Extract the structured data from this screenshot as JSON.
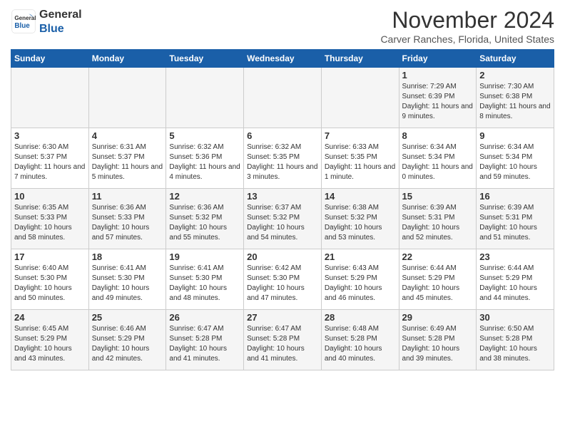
{
  "header": {
    "logo_general": "General",
    "logo_blue": "Blue",
    "month_title": "November 2024",
    "location": "Carver Ranches, Florida, United States"
  },
  "weekdays": [
    "Sunday",
    "Monday",
    "Tuesday",
    "Wednesday",
    "Thursday",
    "Friday",
    "Saturday"
  ],
  "weeks": [
    [
      {
        "day": "",
        "text": ""
      },
      {
        "day": "",
        "text": ""
      },
      {
        "day": "",
        "text": ""
      },
      {
        "day": "",
        "text": ""
      },
      {
        "day": "",
        "text": ""
      },
      {
        "day": "1",
        "text": "Sunrise: 7:29 AM\nSunset: 6:39 PM\nDaylight: 11 hours and 9 minutes."
      },
      {
        "day": "2",
        "text": "Sunrise: 7:30 AM\nSunset: 6:38 PM\nDaylight: 11 hours and 8 minutes."
      }
    ],
    [
      {
        "day": "3",
        "text": "Sunrise: 6:30 AM\nSunset: 5:37 PM\nDaylight: 11 hours and 7 minutes."
      },
      {
        "day": "4",
        "text": "Sunrise: 6:31 AM\nSunset: 5:37 PM\nDaylight: 11 hours and 5 minutes."
      },
      {
        "day": "5",
        "text": "Sunrise: 6:32 AM\nSunset: 5:36 PM\nDaylight: 11 hours and 4 minutes."
      },
      {
        "day": "6",
        "text": "Sunrise: 6:32 AM\nSunset: 5:35 PM\nDaylight: 11 hours and 3 minutes."
      },
      {
        "day": "7",
        "text": "Sunrise: 6:33 AM\nSunset: 5:35 PM\nDaylight: 11 hours and 1 minute."
      },
      {
        "day": "8",
        "text": "Sunrise: 6:34 AM\nSunset: 5:34 PM\nDaylight: 11 hours and 0 minutes."
      },
      {
        "day": "9",
        "text": "Sunrise: 6:34 AM\nSunset: 5:34 PM\nDaylight: 10 hours and 59 minutes."
      }
    ],
    [
      {
        "day": "10",
        "text": "Sunrise: 6:35 AM\nSunset: 5:33 PM\nDaylight: 10 hours and 58 minutes."
      },
      {
        "day": "11",
        "text": "Sunrise: 6:36 AM\nSunset: 5:33 PM\nDaylight: 10 hours and 57 minutes."
      },
      {
        "day": "12",
        "text": "Sunrise: 6:36 AM\nSunset: 5:32 PM\nDaylight: 10 hours and 55 minutes."
      },
      {
        "day": "13",
        "text": "Sunrise: 6:37 AM\nSunset: 5:32 PM\nDaylight: 10 hours and 54 minutes."
      },
      {
        "day": "14",
        "text": "Sunrise: 6:38 AM\nSunset: 5:32 PM\nDaylight: 10 hours and 53 minutes."
      },
      {
        "day": "15",
        "text": "Sunrise: 6:39 AM\nSunset: 5:31 PM\nDaylight: 10 hours and 52 minutes."
      },
      {
        "day": "16",
        "text": "Sunrise: 6:39 AM\nSunset: 5:31 PM\nDaylight: 10 hours and 51 minutes."
      }
    ],
    [
      {
        "day": "17",
        "text": "Sunrise: 6:40 AM\nSunset: 5:30 PM\nDaylight: 10 hours and 50 minutes."
      },
      {
        "day": "18",
        "text": "Sunrise: 6:41 AM\nSunset: 5:30 PM\nDaylight: 10 hours and 49 minutes."
      },
      {
        "day": "19",
        "text": "Sunrise: 6:41 AM\nSunset: 5:30 PM\nDaylight: 10 hours and 48 minutes."
      },
      {
        "day": "20",
        "text": "Sunrise: 6:42 AM\nSunset: 5:30 PM\nDaylight: 10 hours and 47 minutes."
      },
      {
        "day": "21",
        "text": "Sunrise: 6:43 AM\nSunset: 5:29 PM\nDaylight: 10 hours and 46 minutes."
      },
      {
        "day": "22",
        "text": "Sunrise: 6:44 AM\nSunset: 5:29 PM\nDaylight: 10 hours and 45 minutes."
      },
      {
        "day": "23",
        "text": "Sunrise: 6:44 AM\nSunset: 5:29 PM\nDaylight: 10 hours and 44 minutes."
      }
    ],
    [
      {
        "day": "24",
        "text": "Sunrise: 6:45 AM\nSunset: 5:29 PM\nDaylight: 10 hours and 43 minutes."
      },
      {
        "day": "25",
        "text": "Sunrise: 6:46 AM\nSunset: 5:29 PM\nDaylight: 10 hours and 42 minutes."
      },
      {
        "day": "26",
        "text": "Sunrise: 6:47 AM\nSunset: 5:28 PM\nDaylight: 10 hours and 41 minutes."
      },
      {
        "day": "27",
        "text": "Sunrise: 6:47 AM\nSunset: 5:28 PM\nDaylight: 10 hours and 41 minutes."
      },
      {
        "day": "28",
        "text": "Sunrise: 6:48 AM\nSunset: 5:28 PM\nDaylight: 10 hours and 40 minutes."
      },
      {
        "day": "29",
        "text": "Sunrise: 6:49 AM\nSunset: 5:28 PM\nDaylight: 10 hours and 39 minutes."
      },
      {
        "day": "30",
        "text": "Sunrise: 6:50 AM\nSunset: 5:28 PM\nDaylight: 10 hours and 38 minutes."
      }
    ]
  ]
}
